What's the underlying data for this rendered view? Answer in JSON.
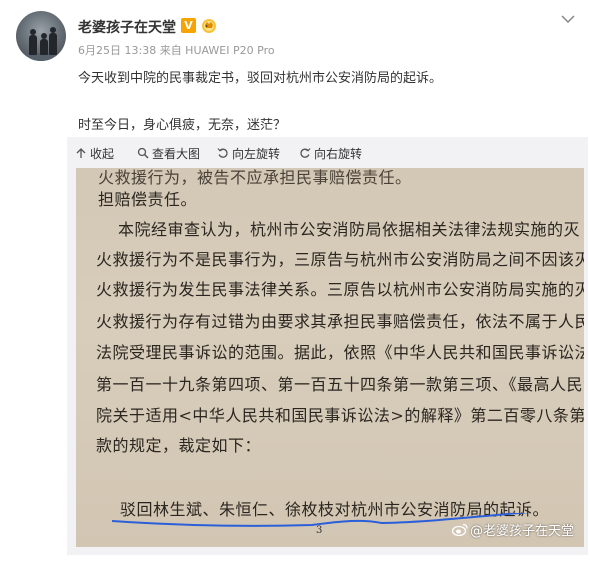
{
  "post": {
    "username": "老婆孩子在天堂",
    "vip_badge": "V",
    "meta": "6月25日 13:38 来自 HUAWEI P20 Pro",
    "text_line1": "今天收到中院的民事裁定书，驳回对杭州市公安消防局的起诉。",
    "text_line2": "时至今日，身心俱疲，无奈，迷茫？"
  },
  "toolbar": {
    "collapse": "收起",
    "view_large": "查看大图",
    "rotate_left": "向左旋转",
    "rotate_right": "向右旋转"
  },
  "document": {
    "lines": [
      "火救援行为，被告不应承担民事赔偿责任。",
      "担赔偿责任。",
      "本院经审查认为，杭州市公安消防局依据相关法律法规实施的灭",
      "火救援行为不是民事行为，三原告与杭州市公安消防局之间不因该灭",
      "火救援行为发生民事法律关系。三原告以杭州市公安消防局实施的灭",
      "火救援行为存有过错为由要求其承担民事赔偿责任，依法不属于人民",
      "法院受理民事诉讼的范围。据此，依照《中华人民共和国民事诉讼法》",
      "第一百一十九条第四项、第一百五十四条第一款第三项、《最高人民法",
      "院关于适用<中华人民共和国民事诉讼法>的解释》第二百零八条第三",
      "款的规定，裁定如下：",
      "驳回林生斌、朱恒仁、徐枚枝对杭州市公安消防局的起诉。"
    ],
    "page_number": "3"
  },
  "watermark": "@老婆孩子在天堂",
  "colors": {
    "vip": "#f7a300",
    "underline": "#2b5fd9",
    "paper": "#d6cab8"
  },
  "icons": {
    "collapse": "collapse-arrow-icon",
    "view_large": "magnifier-icon",
    "rotate_left": "rotate-left-icon",
    "rotate_right": "rotate-right-icon",
    "more": "chevron-down-icon",
    "watermark": "weibo-logo-icon"
  }
}
